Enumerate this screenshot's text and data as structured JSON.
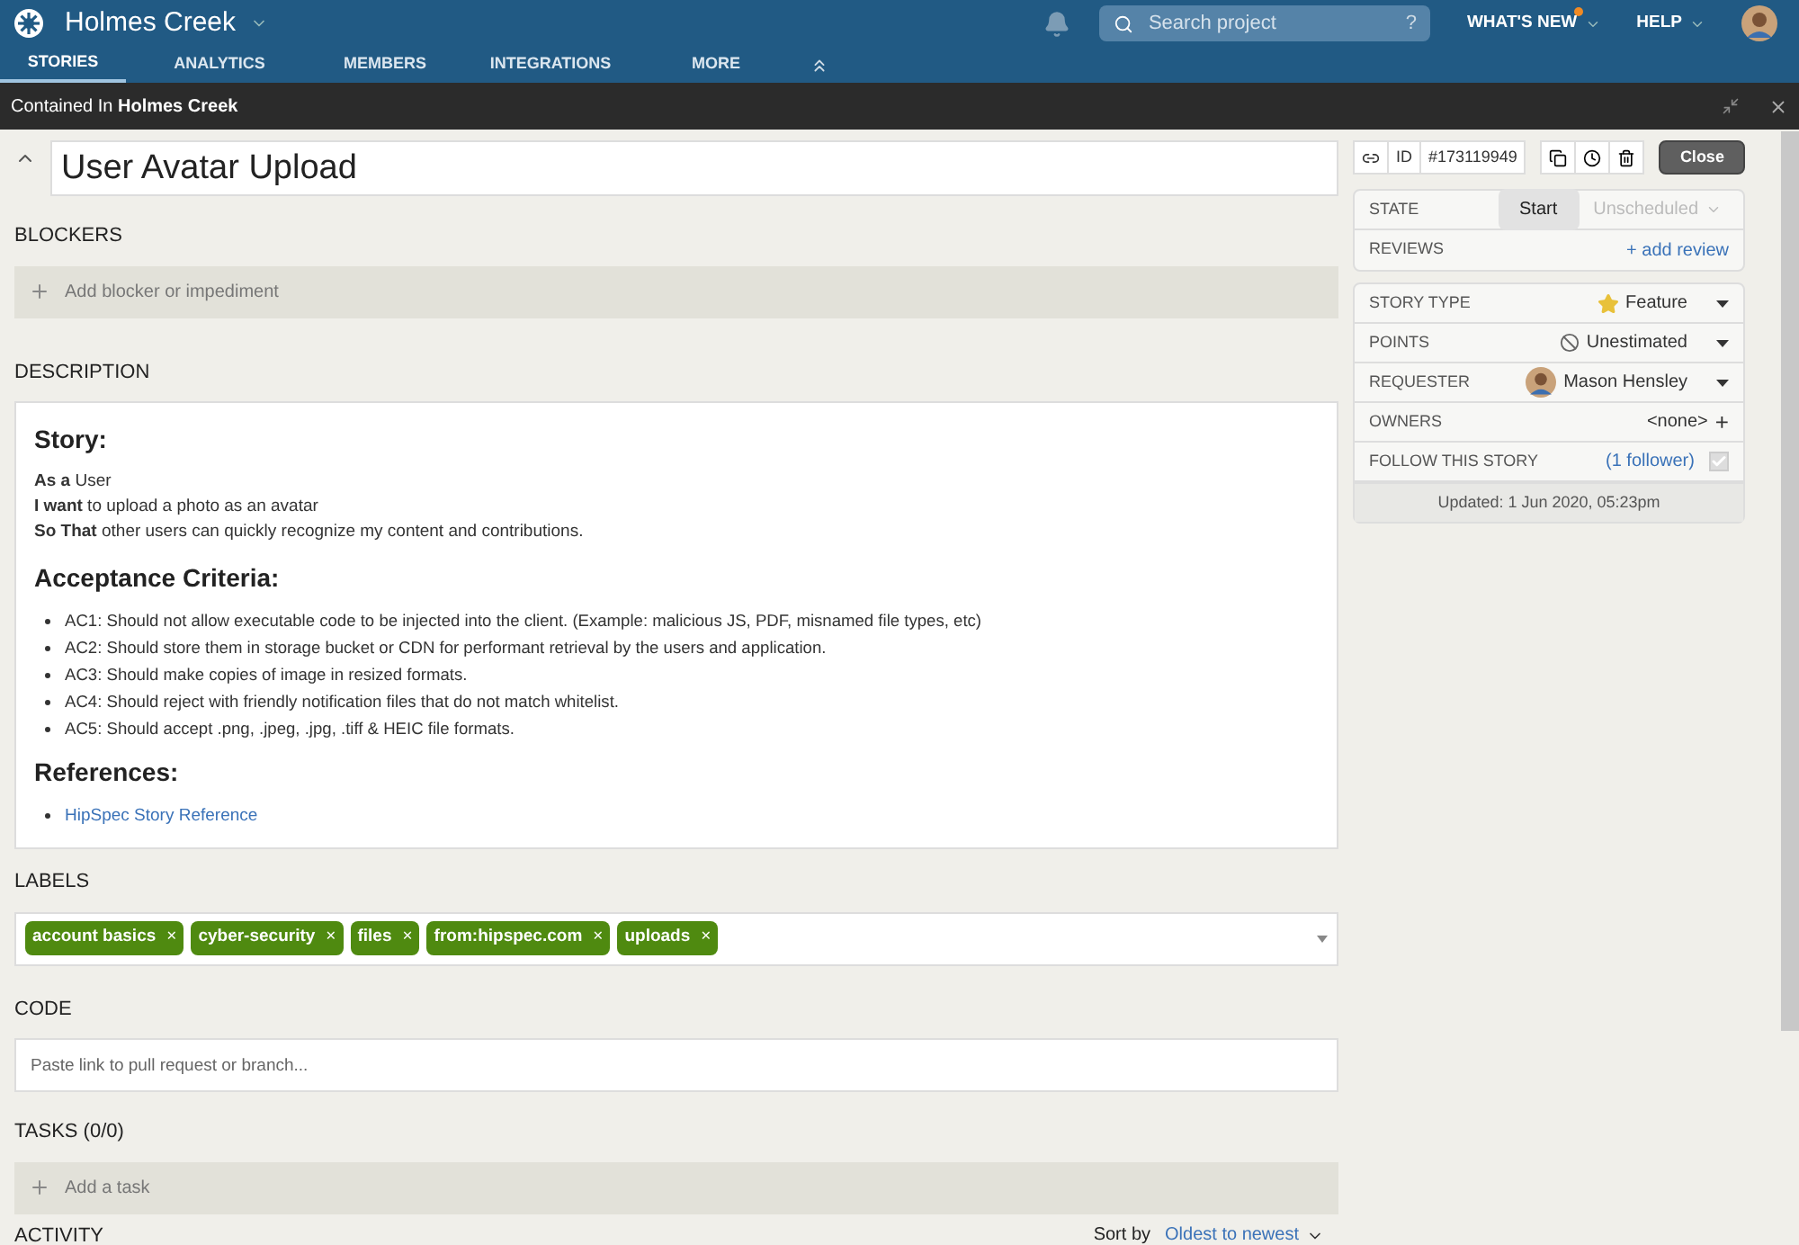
{
  "header": {
    "project": "Holmes Creek",
    "search_placeholder": "Search project",
    "search_help": "?",
    "menus": [
      {
        "label": "WHAT'S NEW",
        "has_update": true
      },
      {
        "label": "HELP",
        "has_update": false
      }
    ]
  },
  "tabs": [
    {
      "label": "STORIES",
      "selected": true
    },
    {
      "label": "ANALYTICS",
      "selected": false
    },
    {
      "label": "MEMBERS",
      "selected": false
    },
    {
      "label": "INTEGRATIONS",
      "selected": false
    },
    {
      "label": "MORE",
      "selected": false
    }
  ],
  "context_bar": {
    "text": "Contained In **Holmes Creek**"
  },
  "story": {
    "title": "User Avatar Upload",
    "id_label": "ID",
    "id": "#173119949",
    "close": "Close"
  },
  "blockers": {
    "heading": "BLOCKERS",
    "add": "Add blocker or impediment"
  },
  "description": {
    "heading": "DESCRIPTION",
    "blocks": [
      {
        "kind": "heading",
        "text": "Story:"
      },
      {
        "kind": "lines",
        "lines": [
          "**As a** User",
          "**I want** to upload a photo as an avatar",
          "**So That** other users can quickly recognize my content and contributions."
        ]
      },
      {
        "kind": "heading",
        "text": "Acceptance Criteria:"
      },
      {
        "kind": "bullets",
        "items": [
          "AC1: Should not allow executable code to be injected into the client. (Example: malicious JS, PDF, misnamed file types, etc)",
          "AC2: Should store them in storage bucket or CDN for performant retrieval by the users and application.",
          "AC3: Should make copies of image in resized formats.",
          "AC4: Should reject with friendly notification files that do not match whitelist.",
          "AC5: Should accept .png, .jpeg, .jpg, .tiff & HEIC file formats."
        ]
      },
      {
        "kind": "heading",
        "text": "References:"
      },
      {
        "kind": "links",
        "items": [
          "HipSpec Story Reference"
        ]
      }
    ]
  },
  "labels": {
    "heading": "LABELS",
    "items": [
      "account basics",
      "cyber-security",
      "files",
      "from:hipspec.com",
      "uploads"
    ],
    "remove": "×"
  },
  "code": {
    "heading": "CODE",
    "placeholder": "Paste link to pull request or branch..."
  },
  "tasks": {
    "heading": "TASKS (0/0)",
    "add": "Add a task"
  },
  "activity": {
    "heading": "ACTIVITY",
    "sort_label": "Sort by",
    "sort_value": "Oldest to newest"
  },
  "panel_top": [
    {
      "kind": "state",
      "label": "STATE",
      "button": "Start",
      "value": "Unscheduled",
      "disabled": true
    },
    {
      "kind": "link",
      "label": "REVIEWS",
      "value": "+ add review"
    }
  ],
  "panel_details": [
    {
      "kind": "story_type",
      "label": "STORY TYPE",
      "value": "Feature"
    },
    {
      "kind": "points",
      "label": "POINTS",
      "value": "Unestimated"
    },
    {
      "kind": "person",
      "label": "REQUESTER",
      "value": "Mason Hensley"
    },
    {
      "kind": "owners",
      "label": "OWNERS",
      "value": "<none>",
      "add": "+"
    },
    {
      "kind": "follow",
      "label": "FOLLOW THIS STORY",
      "open": "(",
      "link": "1 follower",
      "close": ")",
      "checked": true
    }
  ],
  "updated": "Updated: 1 Jun 2020, 05:23pm"
}
